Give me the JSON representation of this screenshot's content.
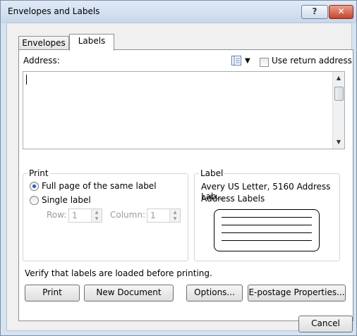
{
  "window": {
    "title": "Envelopes and Labels",
    "help_glyph": "?",
    "close_glyph": "✕"
  },
  "tabs": {
    "envelopes": "Envelopes",
    "labels": "Labels"
  },
  "address": {
    "label": "Address:",
    "value": "",
    "use_return_address_label": "Use return address",
    "use_return_address_checked": false,
    "scroll_up": "▲",
    "scroll_down": "▼",
    "address_book_icon": "address-book-icon",
    "dropdown_arrow": "▼"
  },
  "print_group": {
    "title": "Print",
    "full_page_label": "Full page of the same label",
    "single_label_label": "Single label",
    "selected": "full_page",
    "row_label": "Row:",
    "row_value": "1",
    "column_label": "Column:",
    "column_value": "1",
    "spin_up": "▲",
    "spin_down": "▼"
  },
  "label_group": {
    "title": "Label",
    "product": "Avery US Letter, 5160 Address Lab...",
    "type": "Address Labels"
  },
  "footer": {
    "verify_text": "Verify that labels are loaded before printing.",
    "print_button": "Print",
    "new_document_button": "New Document",
    "options_button": "Options...",
    "epostage_button": "E-postage Properties...",
    "cancel_button": "Cancel"
  },
  "colors": {
    "accent": "#1f5fbf",
    "close_button": "#c7432b",
    "title_bar": "#d6e3f1"
  }
}
